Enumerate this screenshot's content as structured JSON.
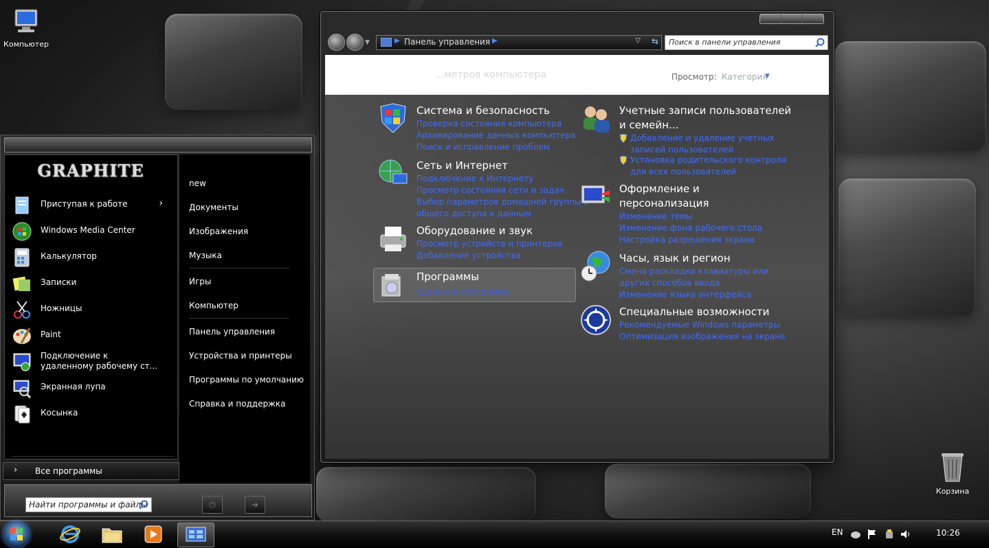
{
  "desktop": {
    "computer_label": "Компьютер",
    "recycle_label": "Корзина"
  },
  "window": {
    "address_crumb": "Панель управления",
    "search_placeholder": "Поиск в панели управления",
    "header_title": "...метров компьютера",
    "view_label": "Просмотр:",
    "view_value": "Категория",
    "categories_left": [
      {
        "title": "Система и безопасность",
        "links": [
          "Проверка состояния компьютера",
          "Архивирование данных компьютера",
          "Поиск и исправление проблем"
        ]
      },
      {
        "title": "Сеть и Интернет",
        "links": [
          "Подключение к Интернету",
          "Просмотр состояния сети и задач",
          "Выбор параметров домашней группы и",
          "общего доступа к данным"
        ]
      },
      {
        "title": "Оборудование и звук",
        "links": [
          "Просмотр устройств и принтеров",
          "Добавление устройства"
        ]
      },
      {
        "title": "Программы",
        "links": [
          "Удаление программы"
        ]
      }
    ],
    "categories_right": [
      {
        "title_lines": [
          "Учетные записи пользователей",
          "и семейн..."
        ],
        "links": [
          "Добавление и удаление учетных",
          "записей пользователей",
          "Установка родительского контроля",
          "для всех пользователей"
        ]
      },
      {
        "title_lines": [
          "Оформление и",
          "персонализация"
        ],
        "links": [
          "Изменение темы",
          "Изменение фона рабочего стола",
          "Настройка разрешения экрана"
        ]
      },
      {
        "title_lines": [
          "Часы, язык и регион"
        ],
        "links": [
          "Смена раскладки клавиатуры или",
          "других способов ввода",
          "Изменение языка интерфейса"
        ]
      },
      {
        "title_lines": [
          "Специальные возможности"
        ],
        "links": [
          "Рекомендуемые Windows параметры",
          "Оптимизация изображения на экране"
        ]
      }
    ]
  },
  "start_menu": {
    "logo": "GRAPHITE",
    "programs": [
      {
        "label": "Приступая к работе",
        "icon": "getting-started-icon",
        "arrow": "›"
      },
      {
        "label": "Windows Media Center",
        "icon": "media-center-icon"
      },
      {
        "label": "Калькулятор",
        "icon": "calculator-icon"
      },
      {
        "label": "Записки",
        "icon": "sticky-notes-icon"
      },
      {
        "label": "Ножницы",
        "icon": "scissors-icon"
      },
      {
        "label": "Paint",
        "icon": "paint-icon"
      },
      {
        "label_lines": [
          "Подключение к",
          "удаленному рабочему ст..."
        ],
        "icon": "remote-desktop-icon"
      },
      {
        "label": "Экранная лупа",
        "icon": "magnifier-icon"
      },
      {
        "label": "Косынка",
        "icon": "solitaire-icon"
      }
    ],
    "places": [
      "new",
      "Документы",
      "Изображения",
      "Музыка",
      "Игры",
      "Компьютер",
      "Панель управления",
      "Устройства и принтеры",
      "Программы по умолчанию",
      "Справка и поддержка"
    ],
    "all_programs": "Все программы",
    "search_placeholder": "Найти программы и файлы"
  },
  "taskbar": {
    "lang": "EN",
    "time": "10:26"
  }
}
